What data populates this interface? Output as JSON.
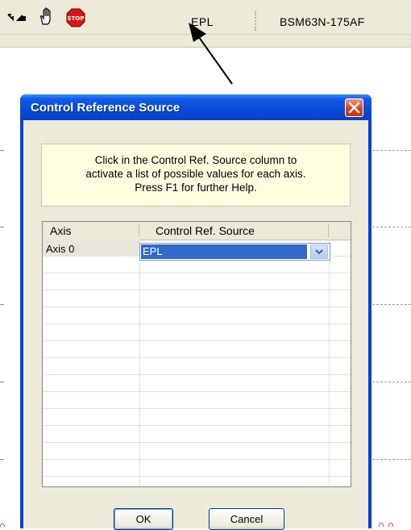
{
  "toolbar": {
    "icons": [
      "cursor-arrows-icon",
      "hand-icon",
      "stop-sign-icon"
    ],
    "stop_label": "STOP",
    "mode_label": "EPL",
    "device_label": "BSM63N-175AF"
  },
  "dialog": {
    "title": "Control Reference Source",
    "help_lines": [
      "Click in the Control Ref. Source column to",
      "activate a list of possible values for each axis.",
      "Press F1 for further Help."
    ],
    "columns": [
      "Axis",
      "Control Ref.  Source"
    ],
    "rows": [
      {
        "axis": "Axis 0",
        "source": "EPL"
      }
    ],
    "ok_label": "OK",
    "cancel_label": "Cancel"
  },
  "colors": {
    "title_bar": "#0a4ad8",
    "selection": "#316ac5",
    "help_bg": "#ffffe1",
    "close_button": "#d9441c"
  }
}
